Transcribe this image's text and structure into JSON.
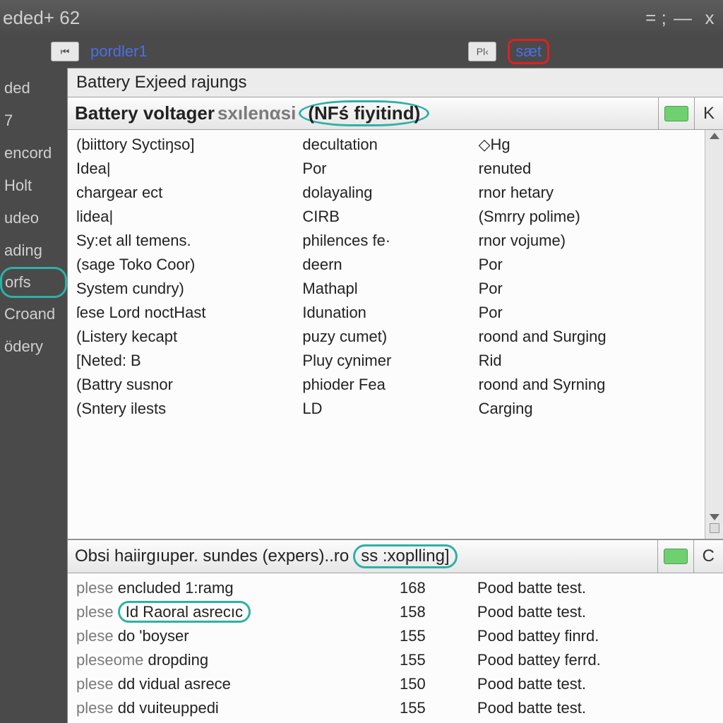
{
  "window": {
    "title": "eded+ 62",
    "min": "—",
    "restore": "□",
    "close": "x",
    "extra": "= ;"
  },
  "toolbar": {
    "icon1": "⏮",
    "link1": "pordler1",
    "icon2": "Pl‹",
    "link2": "sæt"
  },
  "sidebar": {
    "items": [
      "ded",
      "7",
      "encord",
      "Holt",
      "udeo",
      "ading",
      "orfs",
      "Croand",
      "ödery"
    ]
  },
  "panel1": {
    "small_title": "Battery Exjeed rajungs",
    "header_a": "Battery  voltager",
    "header_b": "sxılenαsi",
    "header_c": "(NFś fiyitind)",
    "side_letter": "K",
    "rows": [
      {
        "c1": "(biittory Syctiŋso]",
        "c2": "decultation",
        "c3": "◇Hg"
      },
      {
        "c1": "Idea|",
        "c2": "Por",
        "c3": "renuted"
      },
      {
        "c1": "chargear ect",
        "c2": "dolayaling",
        "c3": "rnor hetary"
      },
      {
        "c1": "lidea|",
        "c2": "CIRB",
        "c3": "(Smrry polime)"
      },
      {
        "c1": "Sy:et all temens.",
        "c2": "philences fe·",
        "c3": "rnor vojume)"
      },
      {
        "c1": "(sage Toko Coor)",
        "c2": "deern",
        "c3": "Por"
      },
      {
        "c1": "System cundry)",
        "c2": "Mathapl",
        "c3": "Por"
      },
      {
        "c1": "ſese Lord noctHast",
        "c2": "Idunation",
        "c3": "Por"
      },
      {
        "c1": "(Listery kecapt",
        "c2": "puzy cumet)",
        "c3": "roond and Surging"
      },
      {
        "c1": "[Neted: B",
        "c2": "Pluy cynimer",
        "c3": "Rid"
      },
      {
        "c1": "(Battry susnor",
        "c2": "phioder Fea",
        "c3": "roond and Syrning"
      },
      {
        "c1": "(Sntery ilests",
        "c2": "LD",
        "c3": "Carging"
      }
    ]
  },
  "panel2": {
    "header_a": "Obsi haiirgıuper. sundes (expers)..ro",
    "header_b": "ss :xoplling]",
    "side_letter": "C",
    "rows": [
      {
        "c1a": "plese",
        "c1b": "encluded 1:ramg",
        "c2": "168",
        "c3": "Pood batte test."
      },
      {
        "c1a": "plese",
        "c1b": "Id Raoral asrecıc",
        "c1b_circle": true,
        "c2": "158",
        "c3": "Pood batte test."
      },
      {
        "c1a": "plese",
        "c1b": "do 'boyser",
        "c2": "155",
        "c3": "Pood battey finrd."
      },
      {
        "c1a": "pleseome",
        "c1b": "dropding",
        "c2": "155",
        "c3": "Pood battey ferrd."
      },
      {
        "c1a": "plese",
        "c1b": "dd vidual asrece",
        "c2": "150",
        "c3": "Pood batte test."
      },
      {
        "c1a": "plese",
        "c1b": "dd vuiteuppedi",
        "c2": "155",
        "c3": "Pood batte test."
      }
    ]
  }
}
